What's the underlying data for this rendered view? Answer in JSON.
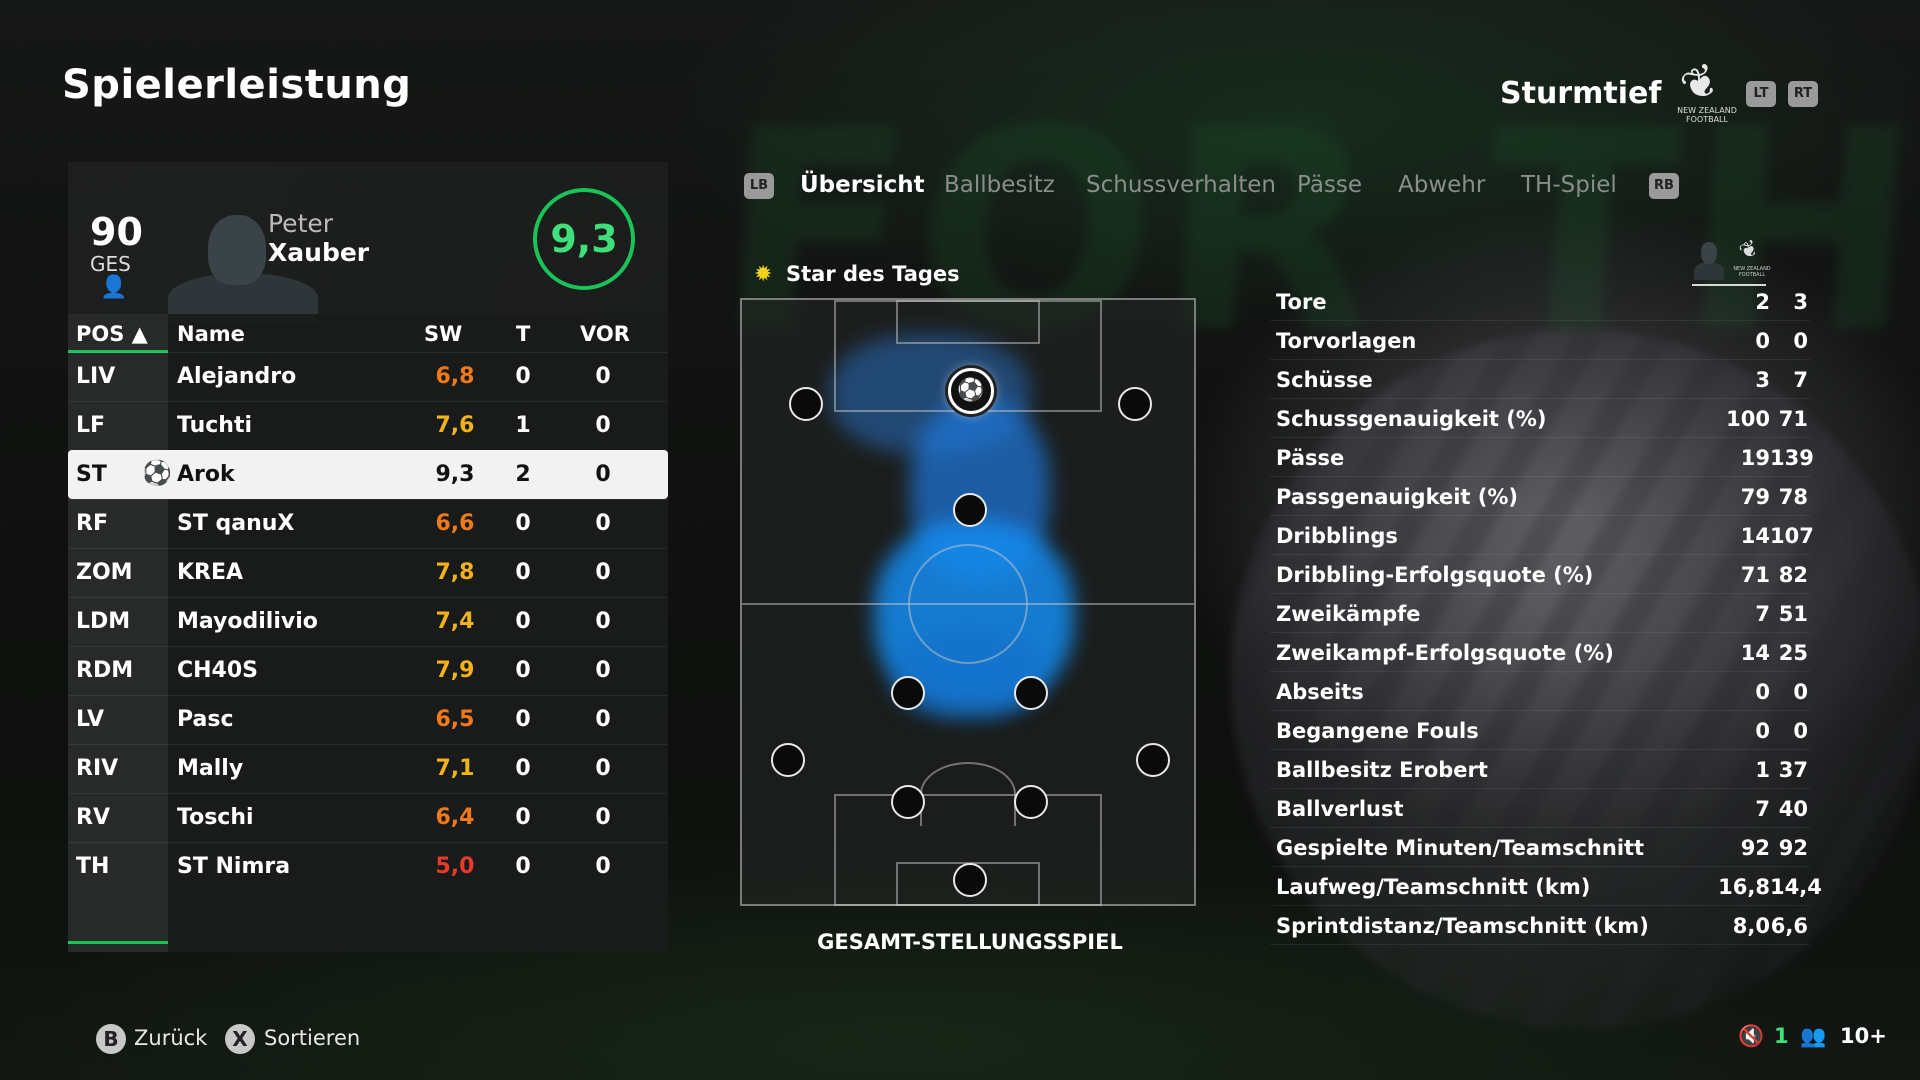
{
  "header": {
    "title": "Spielerleistung",
    "team_name": "Sturmtief",
    "team_logo_icon": "fern-icon",
    "team_logo_caption": "NEW ZEALAND FOOTBALL",
    "lt": "LT",
    "rt": "RT"
  },
  "player": {
    "overall": "90",
    "overall_label": "GES",
    "first_name": "Peter",
    "last_name": "Xauber",
    "rating": "9,3"
  },
  "table": {
    "headers": {
      "pos": "POS ▲",
      "name": "Name",
      "rating": "SW",
      "goals": "T",
      "assists": "VOR"
    },
    "rows": [
      {
        "pos": "LIV",
        "name": "Alejandro",
        "rating": "6,8",
        "goals": "0",
        "assists": "0",
        "color": "#f07a1a"
      },
      {
        "pos": "LF",
        "name": "Tuchti",
        "rating": "7,6",
        "goals": "1",
        "assists": "0",
        "color": "#f2b31a"
      },
      {
        "pos": "ST",
        "name": "Arok",
        "rating": "9,3",
        "goals": "2",
        "assists": "0",
        "color": "#111111"
      },
      {
        "pos": "RF",
        "name": "ST qanuX",
        "rating": "6,6",
        "goals": "0",
        "assists": "0",
        "color": "#f07a1a"
      },
      {
        "pos": "ZOM",
        "name": "KREA",
        "rating": "7,8",
        "goals": "0",
        "assists": "0",
        "color": "#f2b31a"
      },
      {
        "pos": "LDM",
        "name": "Mayodilivio",
        "rating": "7,4",
        "goals": "0",
        "assists": "0",
        "color": "#f2b31a"
      },
      {
        "pos": "RDM",
        "name": "CH40S",
        "rating": "7,9",
        "goals": "0",
        "assists": "0",
        "color": "#f2b31a"
      },
      {
        "pos": "LV",
        "name": "Pasc",
        "rating": "6,5",
        "goals": "0",
        "assists": "0",
        "color": "#f07a1a"
      },
      {
        "pos": "RIV",
        "name": "Mally",
        "rating": "7,1",
        "goals": "0",
        "assists": "0",
        "color": "#f2b31a"
      },
      {
        "pos": "RV",
        "name": "Toschi",
        "rating": "6,4",
        "goals": "0",
        "assists": "0",
        "color": "#f07a1a"
      },
      {
        "pos": "TH",
        "name": "ST Nimra",
        "rating": "5,0",
        "goals": "0",
        "assists": "0",
        "color": "#e83a2a"
      }
    ]
  },
  "tabs": {
    "lb": "LB",
    "rb": "RB",
    "items": [
      "Übersicht",
      "Ballbesitz",
      "Schussverhalten",
      "Pässe",
      "Abwehr",
      "TH-Spiel"
    ],
    "active": "Übersicht"
  },
  "pitch": {
    "star_label": "Star des Tages",
    "caption": "GESAMT-STELLUNGSSPIEL"
  },
  "stats": [
    {
      "label": "Tore",
      "player": "2",
      "team": "3"
    },
    {
      "label": "Torvorlagen",
      "player": "0",
      "team": "0"
    },
    {
      "label": "Schüsse",
      "player": "3",
      "team": "7"
    },
    {
      "label": "Schussgenauigkeit (%)",
      "player": "100",
      "team": "71"
    },
    {
      "label": "Pässe",
      "player": "19",
      "team": "139"
    },
    {
      "label": "Passgenauigkeit (%)",
      "player": "79",
      "team": "78"
    },
    {
      "label": "Dribblings",
      "player": "14",
      "team": "107"
    },
    {
      "label": "Dribbling-Erfolgsquote (%)",
      "player": "71",
      "team": "82"
    },
    {
      "label": "Zweikämpfe",
      "player": "7",
      "team": "51"
    },
    {
      "label": "Zweikampf-Erfolgsquote (%)",
      "player": "14",
      "team": "25"
    },
    {
      "label": "Abseits",
      "player": "0",
      "team": "0"
    },
    {
      "label": "Begangene Fouls",
      "player": "0",
      "team": "0"
    },
    {
      "label": "Ballbesitz Erobert",
      "player": "1",
      "team": "37"
    },
    {
      "label": "Ballverlust",
      "player": "7",
      "team": "40"
    },
    {
      "label": "Gespielte Minuten/Teamschnitt",
      "player": "92",
      "team": "92"
    },
    {
      "label": "Laufweg/Teamschnitt (km)",
      "player": "16,8",
      "team": "14,4"
    },
    {
      "label": "Sprintdistanz/Teamschnitt (km)",
      "player": "8,0",
      "team": "6,6"
    }
  ],
  "stats_head_caption": "NEW ZEALAND FOOTBALL",
  "footer": {
    "back_key": "B",
    "back_label": "Zurück",
    "sort_key": "X",
    "sort_label": "Sortieren",
    "muted_count": "1",
    "party_count": "10+"
  }
}
